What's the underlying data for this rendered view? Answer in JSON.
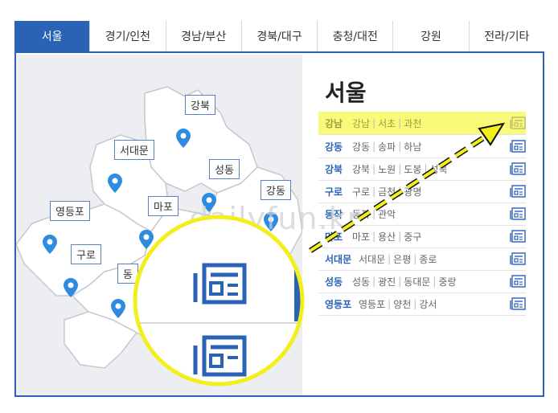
{
  "tabs": [
    "서울",
    "경기/인천",
    "경남/부산",
    "경북/대구",
    "충청/대전",
    "강원",
    "전라/기타"
  ],
  "sidebar": {
    "title": "서울",
    "rows": [
      {
        "main": "강남",
        "subs": [
          "강남",
          "서초",
          "과천"
        ]
      },
      {
        "main": "강동",
        "subs": [
          "강동",
          "송파",
          "하남"
        ]
      },
      {
        "main": "강북",
        "subs": [
          "강북",
          "노원",
          "도봉",
          "성북"
        ]
      },
      {
        "main": "구로",
        "subs": [
          "구로",
          "금천",
          "광명"
        ]
      },
      {
        "main": "동작",
        "subs": [
          "동작",
          "관악"
        ]
      },
      {
        "main": "마포",
        "subs": [
          "마포",
          "용산",
          "중구"
        ]
      },
      {
        "main": "서대문",
        "subs": [
          "서대문",
          "은평",
          "종로"
        ]
      },
      {
        "main": "성동",
        "subs": [
          "성동",
          "광진",
          "동대문",
          "중랑"
        ]
      },
      {
        "main": "영등포",
        "subs": [
          "영등포",
          "양천",
          "강서"
        ]
      }
    ]
  },
  "map_labels": [
    "강북",
    "서대문",
    "성동",
    "강동",
    "마포",
    "영등포",
    "구로",
    "동"
  ],
  "watermark": "dailyfun.kr",
  "colors": {
    "accent": "#2a62b5",
    "highlight": "#fafa7a",
    "magnifier": "#f3ef1c"
  }
}
